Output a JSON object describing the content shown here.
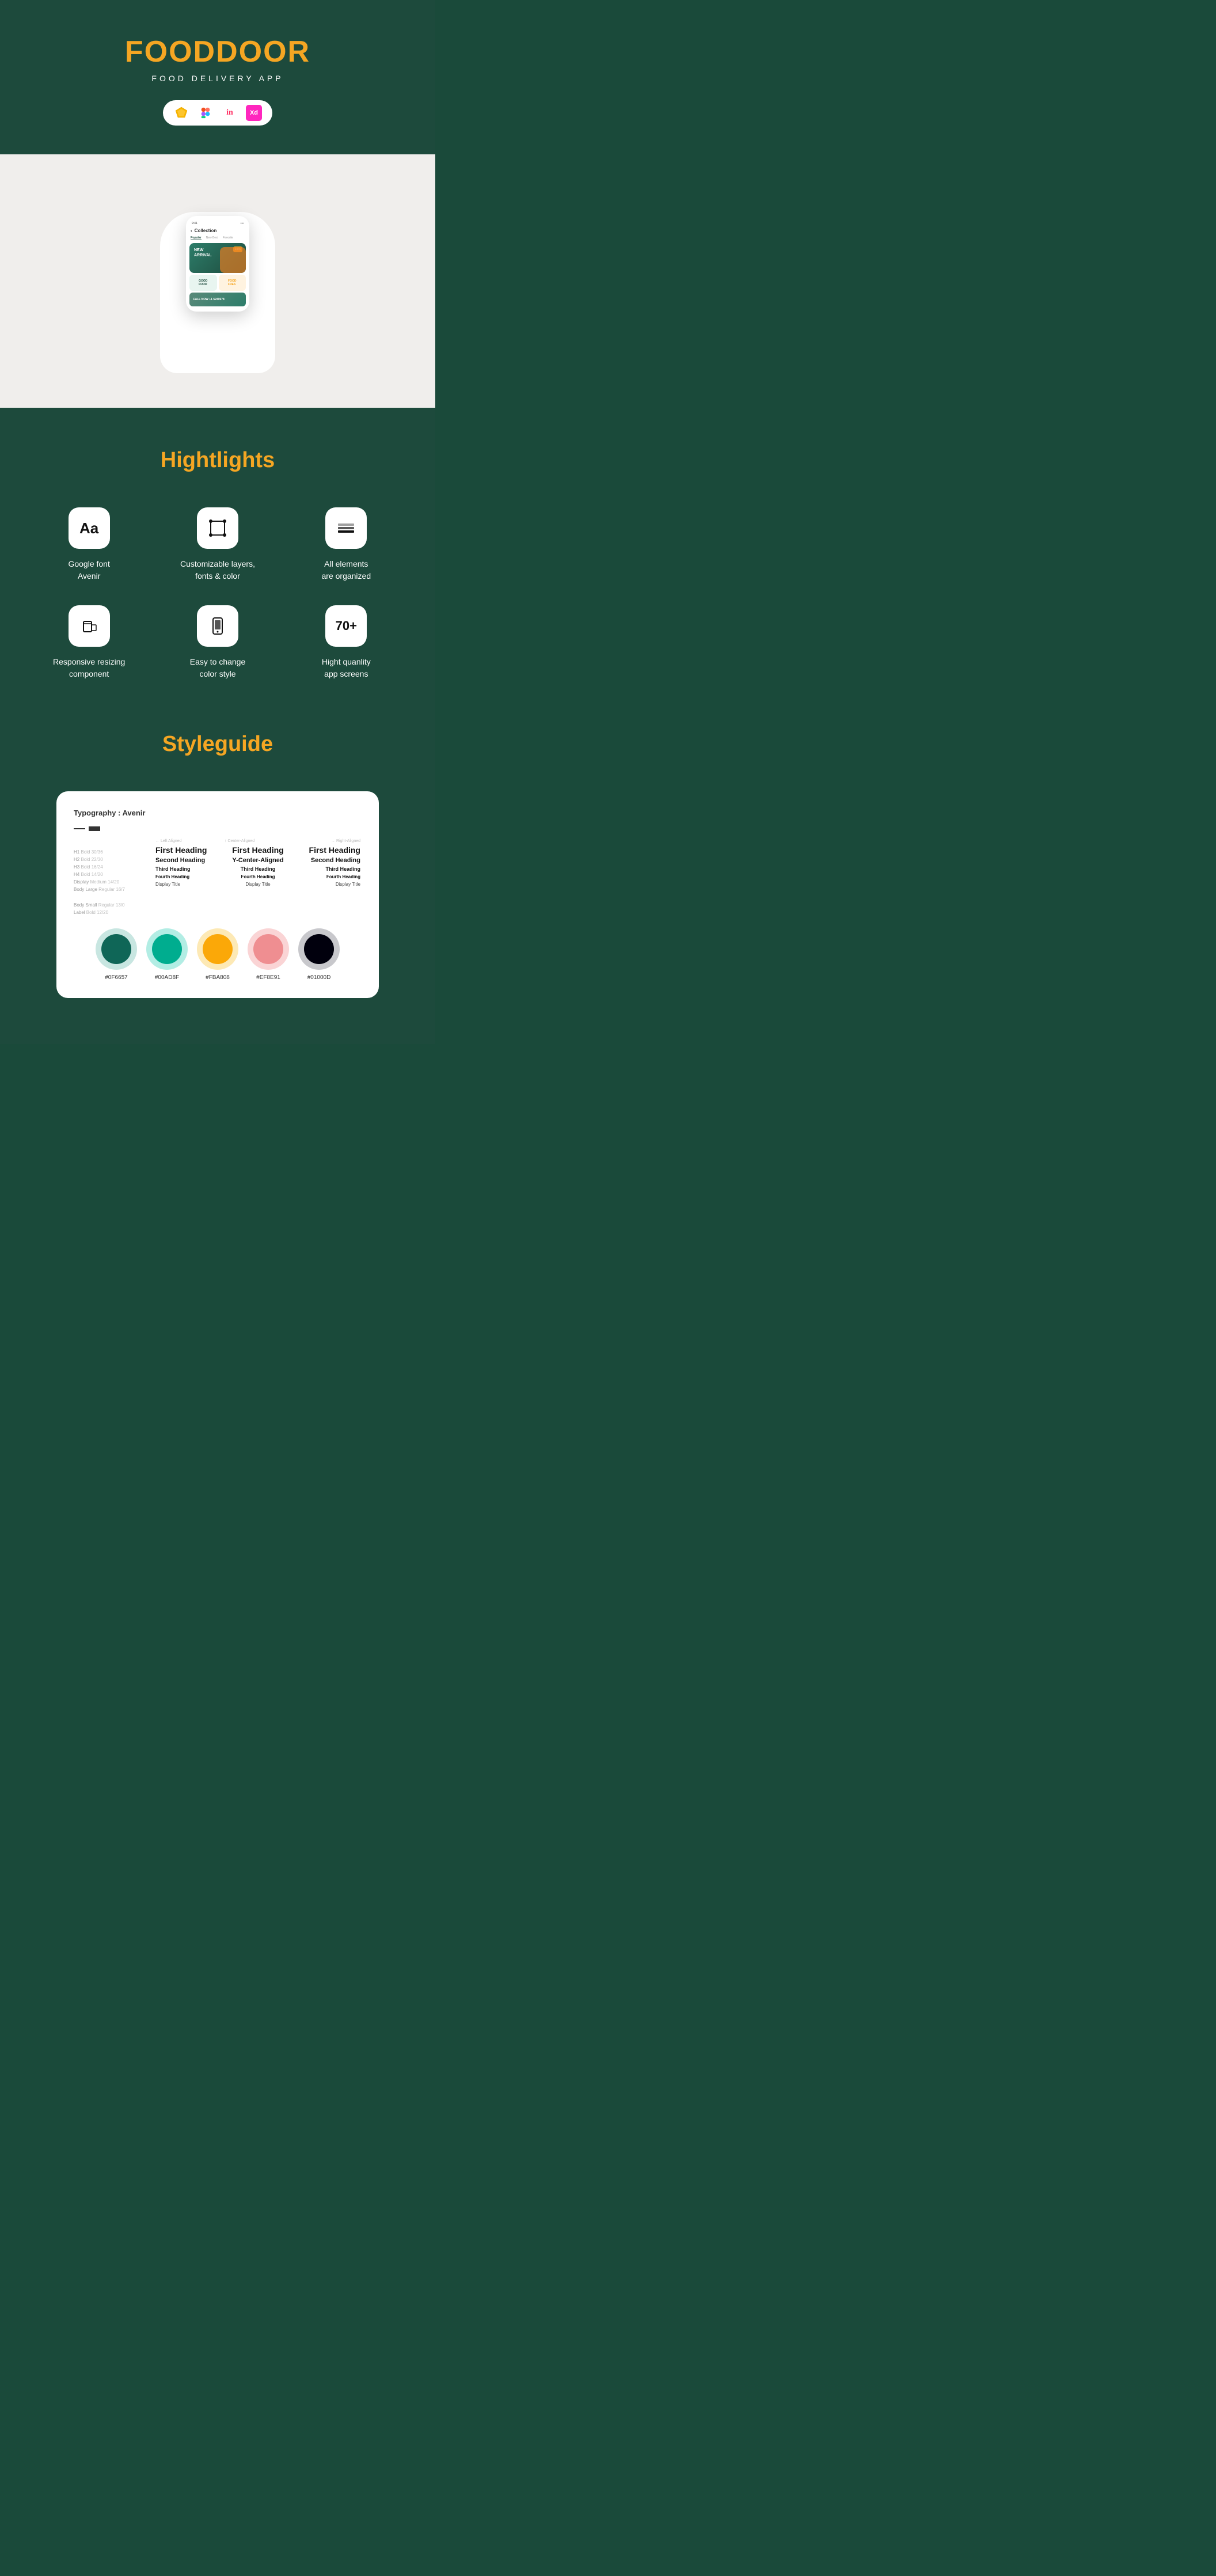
{
  "header": {
    "title": "FOODDOOR",
    "subtitle": "FOOD DELIVERY APP",
    "tools": [
      {
        "name": "Sketch",
        "symbol": "◈",
        "id": "sketch"
      },
      {
        "name": "Figma",
        "symbol": "𝑭",
        "id": "figma"
      },
      {
        "name": "InVision",
        "symbol": "in",
        "id": "invision"
      },
      {
        "name": "Adobe XD",
        "symbol": "Xd",
        "id": "xd"
      }
    ]
  },
  "phone": {
    "collection_label": "Collection",
    "tabs": [
      "Popular",
      "New Best",
      "Favorite"
    ],
    "banner_heading": "NEW\nARRIVAL",
    "banner_badge": "15%",
    "cards": [
      "GOOD\nFOOD",
      "FOOD\nFRES",
      "CALL NOW\n+1 5249678"
    ]
  },
  "highlights": {
    "section_title": "Hightlights",
    "items": [
      {
        "id": "google-font",
        "icon_type": "text",
        "icon_content": "Aa",
        "label": "Google font\nAvenir"
      },
      {
        "id": "customizable-layers",
        "icon_type": "vector",
        "icon_content": "⊞",
        "label": "Customizable layers,\nfonts & color"
      },
      {
        "id": "all-elements",
        "icon_type": "layers",
        "icon_content": "⊕",
        "label": "All elements\nare organized"
      },
      {
        "id": "responsive-resizing",
        "icon_type": "resize",
        "icon_content": "⊟",
        "label": "Responsive resizing\ncomponent"
      },
      {
        "id": "easy-color",
        "icon_type": "phone",
        "icon_content": "▣",
        "label": "Easy to change\ncolor style"
      },
      {
        "id": "high-quality",
        "icon_type": "number",
        "icon_content": "70+",
        "label": "Hight quanlity\napp screens"
      }
    ]
  },
  "styleguide": {
    "section_title": "Styleguide",
    "typography_title": "Typography : Avenir",
    "columns": {
      "left_aligned": "← Left Aligned",
      "center_aligned": "↑ Center-Aligned",
      "right_aligned": "→ Right-Aligned"
    },
    "type_rows": [
      {
        "tag": "H1",
        "spec": "Bold 30/36",
        "text": "First Heading"
      },
      {
        "tag": "H2",
        "spec": "Bold 22/30",
        "text": "Second Heading"
      },
      {
        "tag": "H3",
        "spec": "Bold 16/24",
        "text": "Third Heading"
      },
      {
        "tag": "H4",
        "spec": "Bold 14/20",
        "text": "Fourth Heading"
      },
      {
        "tag": "Display",
        "spec": "Medium 14/20",
        "text": "Display Title"
      },
      {
        "tag": "Body Large",
        "spec": "Regular 16/7",
        "text": ""
      },
      {
        "tag": "Body Small",
        "spec": "Regular 13/0",
        "text": ""
      },
      {
        "tag": "Label",
        "spec": "Bold 12/20",
        "text": ""
      }
    ],
    "colors": [
      {
        "hex": "#0F6657",
        "label": "#0F6657",
        "light_bg": "#c8e6e1"
      },
      {
        "hex": "#00AD8F",
        "label": "#00AD8F",
        "light_bg": "#b2ede4"
      },
      {
        "hex": "#FBA808",
        "label": "#FBA808",
        "light_bg": "#fde9b5"
      },
      {
        "hex": "#EF8E91",
        "label": "#EF8E91",
        "light_bg": "#fad4d5"
      },
      {
        "hex": "#01000D",
        "label": "#01000D",
        "light_bg": "#c8c8cc"
      }
    ]
  }
}
